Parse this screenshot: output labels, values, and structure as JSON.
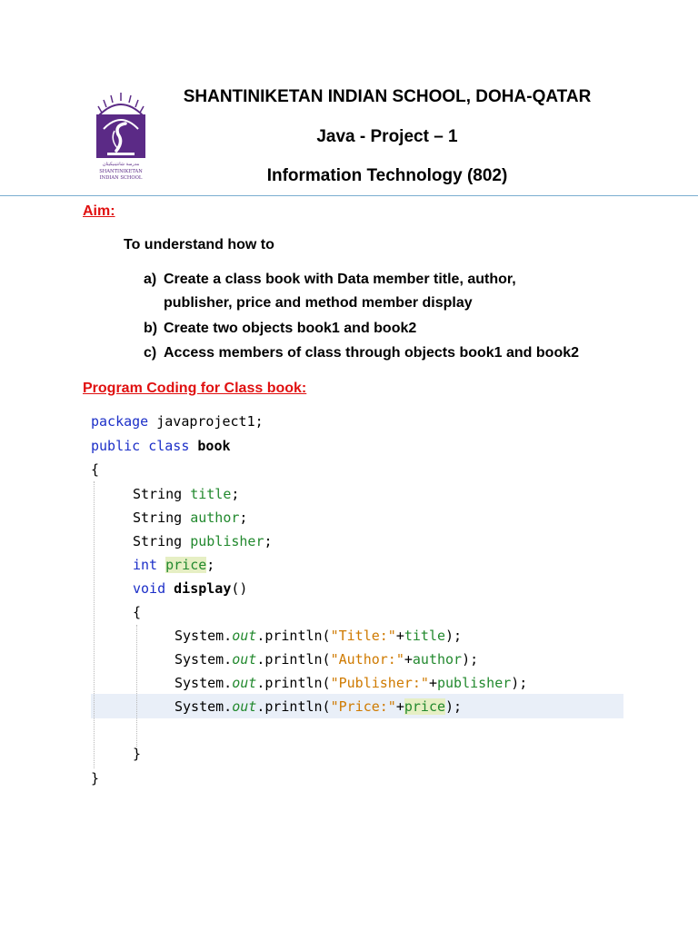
{
  "header": {
    "school": "SHANTINIKETAN INDIAN SCHOOL, DOHA-QATAR",
    "project": "Java -  Project – 1",
    "subject": "Information Technology (802)",
    "logo_caption_1": "SHANTINIKETAN",
    "logo_caption_2": "INDIAN SCHOOL"
  },
  "aim": {
    "heading": "Aim:",
    "intro": "To understand how to",
    "items": [
      {
        "marker": "a)",
        "text": "Create a class book with Data member title, author,",
        "continuation": "publisher, price and method member display"
      },
      {
        "marker": "b)",
        "text": "Create two objects book1 and book2"
      },
      {
        "marker": "c)",
        "text": "Access members of class through objects book1 and book2"
      }
    ]
  },
  "program": {
    "heading": "Program Coding for Class book:",
    "code": {
      "l1_kw": "package",
      "l1_rest": " javaproject1;",
      "l2_kw1": "public",
      "l2_kw2": "class",
      "l2_name": "book",
      "open_brace": "{",
      "f1_type": "String",
      "f1_name": "title",
      "f2_type": "String",
      "f2_name": "author",
      "f3_type": "String",
      "f3_name": "publisher",
      "f4_type": "int",
      "f4_name": "price",
      "m_kw": "void",
      "m_name": "display",
      "m_parens": "()",
      "m_open": "{",
      "p_obj": "System.",
      "p_out": "out",
      "p_call": ".println(",
      "p1_str": "\"Title:\"",
      "p1_var": "title",
      "p2_str": "\"Author:\"",
      "p2_var": "author",
      "p3_str": "\"Publisher:\"",
      "p3_var": "publisher",
      "p4_str": "\"Price:\"",
      "p4_var": "price",
      "plus": "+",
      "close_call": ");",
      "semicolon": ";",
      "m_close": "}",
      "close_brace": "}"
    }
  },
  "colors": {
    "heading_red": "#e01010",
    "keyword_blue": "#1c2fc8",
    "field_green": "#22892e",
    "string_orange": "#cf7a00",
    "logo_purple": "#5b2a86"
  }
}
